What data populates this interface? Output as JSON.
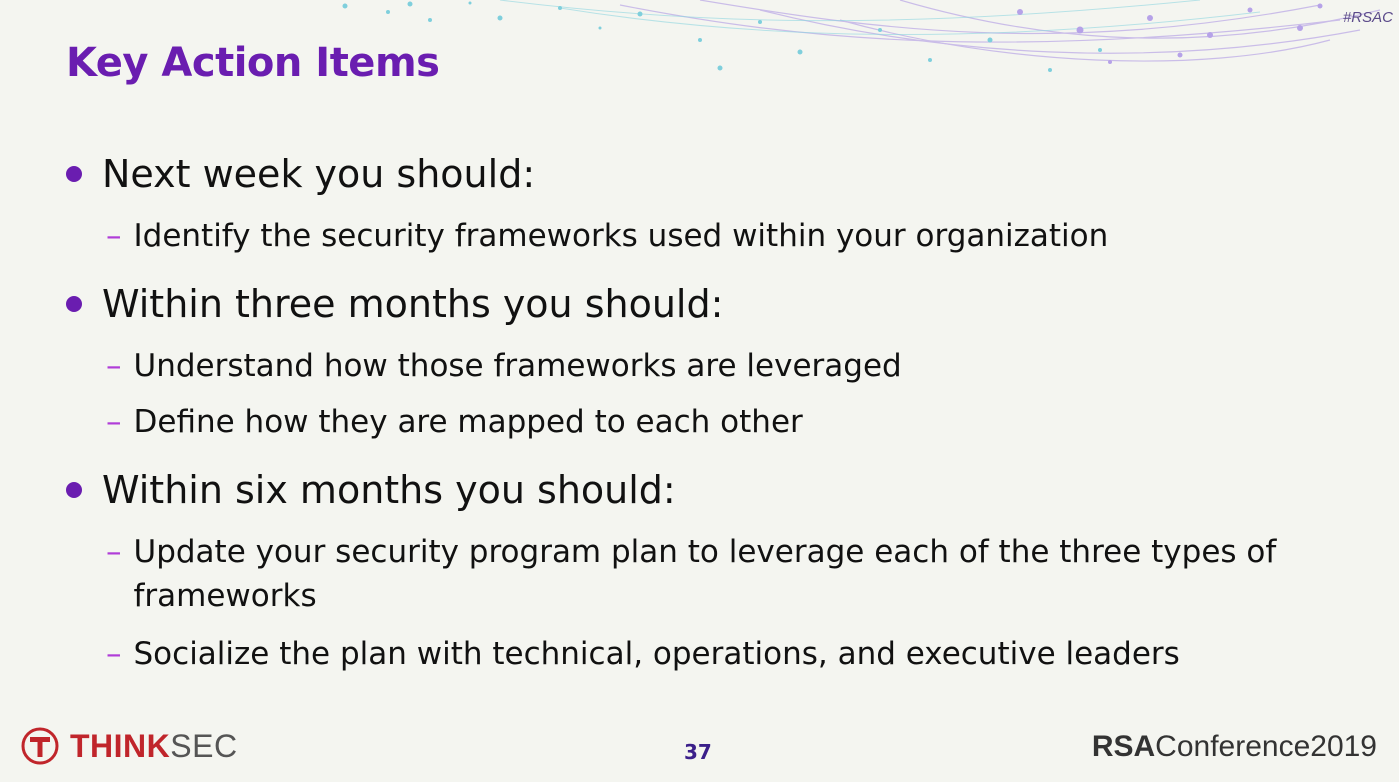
{
  "header": {
    "hashtag": "#RSAC",
    "title": "Key Action Items"
  },
  "sections": [
    {
      "heading": "Next week you should:",
      "items": [
        "Identify the security frameworks used within your organization"
      ]
    },
    {
      "heading": "Within three months you should:",
      "items": [
        "Understand how those frameworks are leveraged",
        "Define how they are mapped to each other"
      ]
    },
    {
      "heading": "Within six months you should:",
      "items": [
        "Update your security program plan to leverage each of the three types of frameworks",
        "Socialize the plan with technical, operations, and executive leaders"
      ]
    }
  ],
  "footer": {
    "logo_bold": "THINK",
    "logo_light": "SEC",
    "page_number": "37",
    "rsa_bold": "RSA",
    "rsa_light": "Conference2019"
  },
  "colors": {
    "title": "#6a1db0",
    "bullet": "#6a1db0",
    "dash": "#b03cd8",
    "logo_red": "#c0252b",
    "background": "#f4f5f0"
  }
}
